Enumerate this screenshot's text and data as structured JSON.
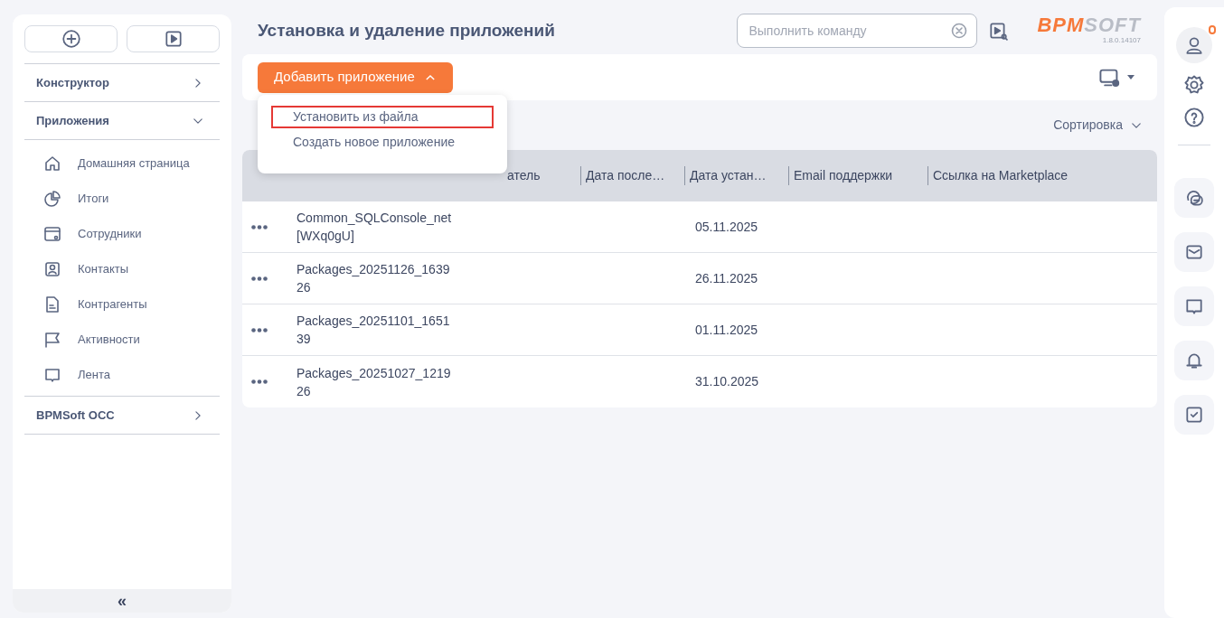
{
  "sidebar": {
    "sections": [
      {
        "label": "Конструктор",
        "expanded": false
      },
      {
        "label": "Приложения",
        "expanded": true,
        "children": [
          {
            "label": "Домашняя страница"
          },
          {
            "label": "Итоги"
          },
          {
            "label": "Сотрудники"
          },
          {
            "label": "Контакты"
          },
          {
            "label": "Контрагенты"
          },
          {
            "label": "Активности"
          },
          {
            "label": "Лента"
          }
        ]
      },
      {
        "label": "BPMSoft OCC",
        "expanded": false
      }
    ]
  },
  "header": {
    "title": "Установка и удаление приложений",
    "command": {
      "placeholder": "Выполнить команду"
    },
    "logo": {
      "part_1": "BPM",
      "part_2": "SOFT",
      "version": "1.8.0.14107"
    }
  },
  "toolbar": {
    "add_button": {
      "label": "Добавить приложение",
      "expanded": true
    },
    "menu": [
      {
        "label": "Установить из файла",
        "selected": true
      },
      {
        "label": "Создать новое приложение",
        "selected": false
      }
    ],
    "sort": "Сортировка"
  },
  "table": {
    "columns": [
      "атель",
      "Дата после…",
      "Дата устан…",
      "Email поддержки",
      "Ссылка на Marketplace"
    ],
    "rows": [
      {
        "name": "Common_SQLConsole_net\n[WXq0gU]",
        "date": "05.11.2025"
      },
      {
        "name": "Packages_20251126_1639\n26",
        "date": "26.11.2025"
      },
      {
        "name": "Packages_20251101_1651\n39",
        "date": "01.11.2025"
      },
      {
        "name": "Packages_20251027_1219\n26",
        "date": "31.10.2025"
      }
    ]
  },
  "collapse": "«",
  "profile": {
    "has_notification": true
  }
}
